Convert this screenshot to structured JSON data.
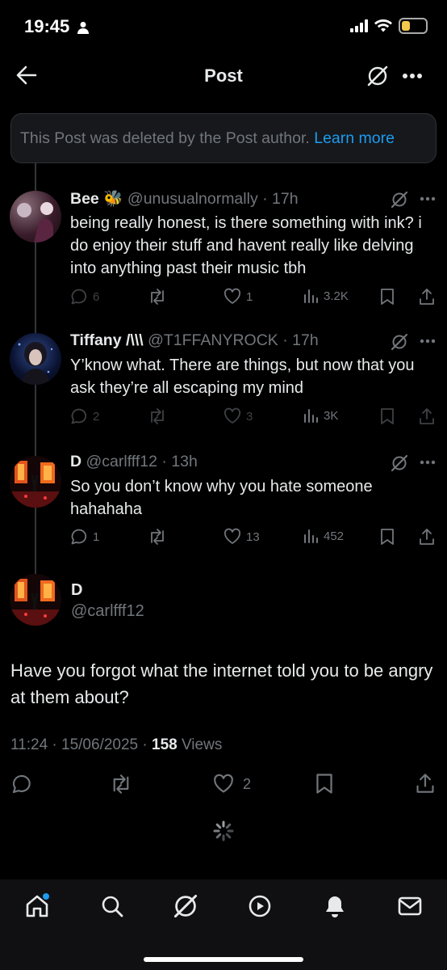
{
  "status_bar": {
    "time": "19:45",
    "battery": "8"
  },
  "header": {
    "title": "Post"
  },
  "notice": {
    "text": "This Post was deleted by the Post author.",
    "link": "Learn more"
  },
  "replies": [
    {
      "name": "Bee 🐝",
      "handle": "@unusualnormally",
      "time": "17h",
      "text": "being really honest, is there something with ink? i do enjoy their stuff and havent really like delving into anything past their music tbh",
      "replies": "6",
      "likes": "1",
      "views": "3.2K"
    },
    {
      "name": "Tiffany /\\\\\\",
      "handle": "@T1FFANYROCK",
      "time": "17h",
      "text": "Y’know what. There are things, but now that you ask they’re all escaping my mind",
      "replies": "2",
      "likes": "3",
      "views": "3K"
    },
    {
      "name": "D",
      "handle": "@carlfff12",
      "time": "13h",
      "text": "So you don’t know why you hate someone hahahaha",
      "replies": "1",
      "likes": "13",
      "views": "452"
    }
  ],
  "main_post": {
    "name": "D",
    "handle": "@carlfff12",
    "text": "Have you forgot what the internet told you to be angry at them about?",
    "timestamp": "11:24 · 15/06/2025 · ",
    "views_count": "158",
    "views_label": " Views",
    "likes": "2"
  },
  "colors": {
    "accent": "#1d9bf0",
    "muted": "#71767b",
    "text": "#e7e9ea",
    "background": "#000000"
  },
  "icons": [
    "back-arrow-icon",
    "grok-icon",
    "more-icon",
    "reply-icon",
    "repost-icon",
    "like-icon",
    "views-icon",
    "bookmark-icon",
    "share-icon",
    "loading-spinner-icon",
    "home-icon",
    "search-icon",
    "notifications-icon",
    "messages-icon",
    "video-icon"
  ]
}
